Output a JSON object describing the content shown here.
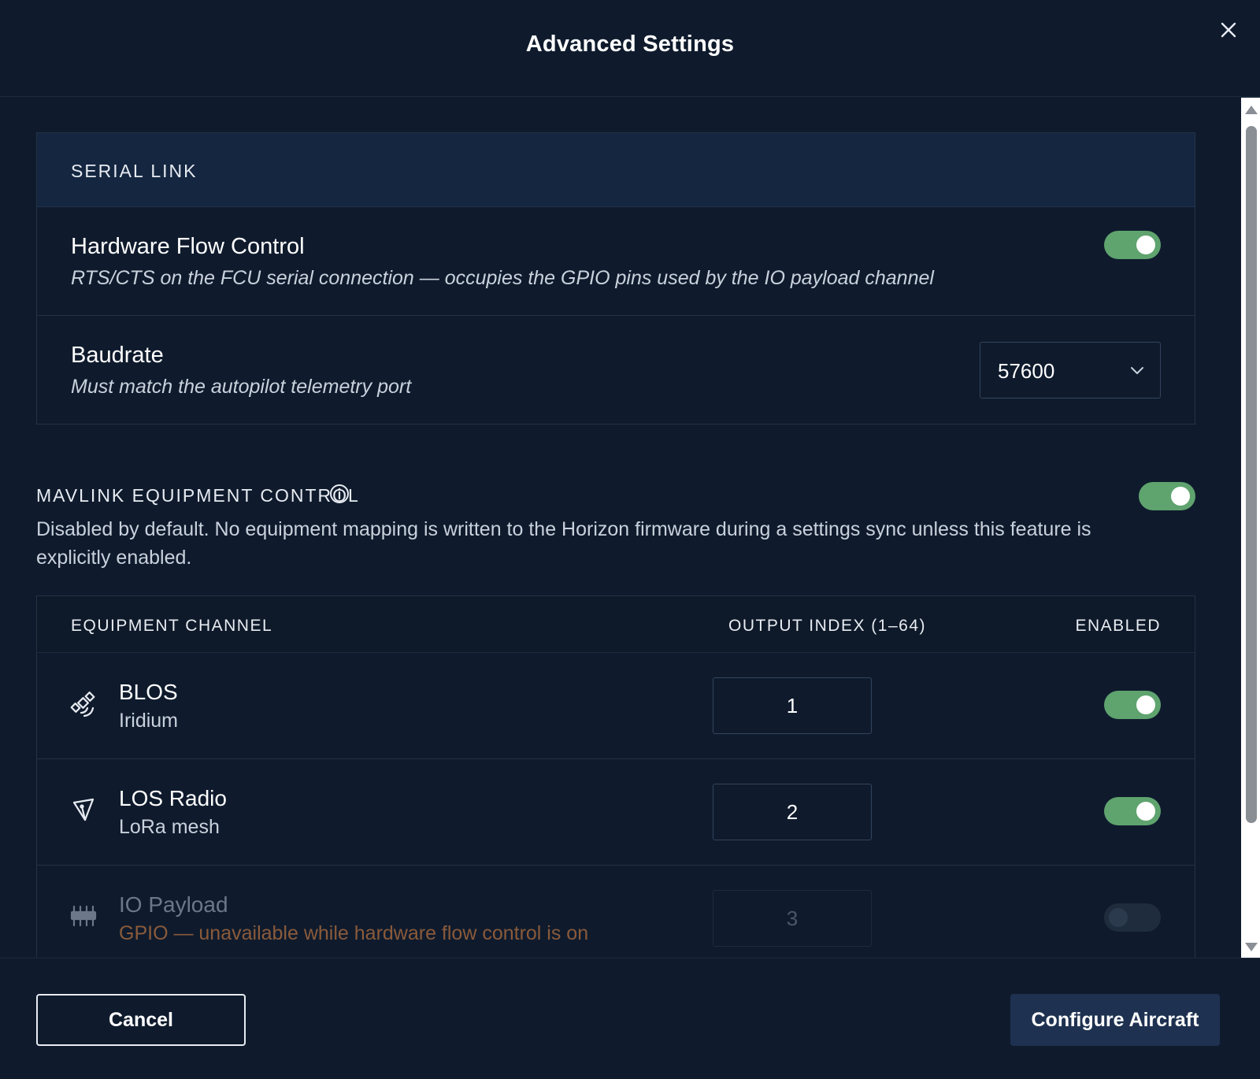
{
  "dialog": {
    "title": "Advanced Settings"
  },
  "serial_link": {
    "section_label": "SERIAL LINK",
    "hardware_flow_control": {
      "title": "Hardware Flow Control",
      "description": "RTS/CTS on the FCU serial connection — occupies the GPIO pins used by the IO payload channel",
      "enabled": true
    },
    "baudrate": {
      "title": "Baudrate",
      "description": "Must match the autopilot telemetry port",
      "selected": "57600"
    }
  },
  "mavlink": {
    "section_label": "MAVLINK EQUIPMENT CONTROL",
    "enabled": true,
    "description": "Disabled by default. No equipment mapping is written to the Horizon firmware during a settings sync unless this feature is explicitly enabled.",
    "table": {
      "headers": {
        "channel": "EQUIPMENT CHANNEL",
        "output_index": "OUTPUT INDEX (1–64)",
        "enabled": "ENABLED"
      },
      "rows": [
        {
          "name": "BLOS",
          "subtitle": "Iridium",
          "output_index": "1",
          "enabled": true,
          "icon": "satellite-icon"
        },
        {
          "name": "LOS Radio",
          "subtitle": "LoRa mesh",
          "output_index": "2",
          "enabled": true,
          "icon": "radio-antenna-icon"
        },
        {
          "name": "IO Payload",
          "subtitle": "GPIO — unavailable while hardware flow control is on",
          "output_index": "3",
          "enabled": false,
          "disabled": true,
          "icon": "gpio-pins-icon"
        }
      ]
    }
  },
  "footer": {
    "cancel_label": "Cancel",
    "primary_label": "Configure Aircraft"
  },
  "colors": {
    "background": "#0f1b2d",
    "section_header": "#142640",
    "toggle_on": "#5fa36e",
    "primary_button": "#1e3150",
    "warning_text": "#8a5a3a"
  }
}
